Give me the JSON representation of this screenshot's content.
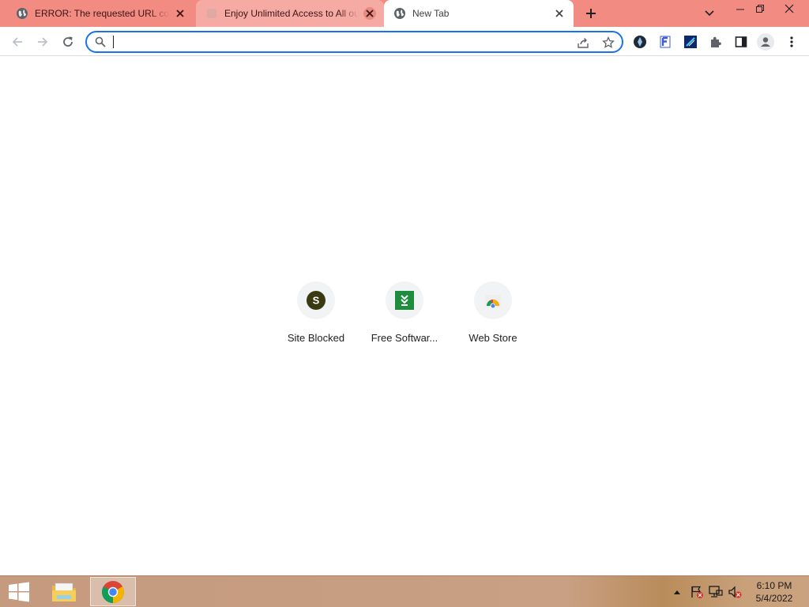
{
  "tabs": [
    {
      "title": "ERROR: The requested URL could not be retrieved",
      "favicon": "globe-icon",
      "active": false
    },
    {
      "title": "Enjoy Unlimited Access to All our",
      "favicon": "blank-page-icon",
      "active": false
    },
    {
      "title": "New Tab",
      "favicon": "globe-icon",
      "active": true
    }
  ],
  "omnibox": {
    "value": "",
    "placeholder": ""
  },
  "toolbar_icons": [
    "back-arrow-icon",
    "forward-arrow-icon",
    "reload-icon",
    "share-icon",
    "bookmark-star-icon",
    "extension-dark-icon",
    "extension-f-icon",
    "extension-blue-icon",
    "extensions-puzzle-icon",
    "side-panel-icon",
    "profile-icon",
    "menu-kebab-icon"
  ],
  "shortcuts": [
    {
      "label": "Site Blocked",
      "icon_letter": "S",
      "icon_color": "#3a3a12"
    },
    {
      "label": "Free Softwar...",
      "icon": "download-chevrons-icon",
      "icon_color": "#1e8e3e"
    },
    {
      "label": "Web Store",
      "icon": "web-store-icon"
    }
  ],
  "taskbar": {
    "apps": [
      "file-explorer-icon",
      "chrome-icon"
    ],
    "tray_icons": [
      "show-hidden-icons-arrow",
      "action-center-flag-icon",
      "network-icon",
      "volume-muted-icon"
    ],
    "time": "6:10 PM",
    "date": "5/4/2022"
  },
  "colors": {
    "tabstrip": "#f28b82",
    "omnibox_focus": "#1a73e8",
    "active_tab": "#ffffff"
  }
}
